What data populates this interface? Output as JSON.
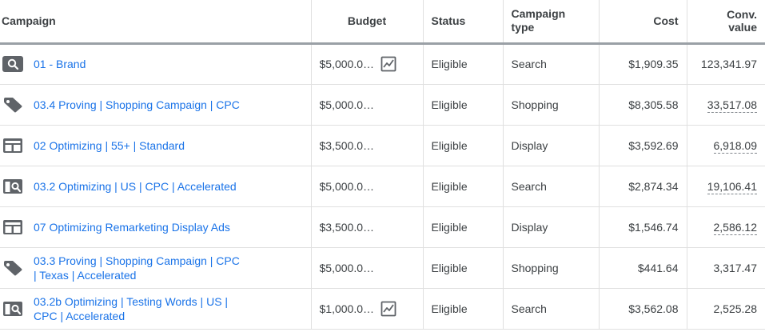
{
  "columns": {
    "campaign": "Campaign",
    "budget": "Budget",
    "status": "Status",
    "type_line1": "Campaign",
    "type_line2": "type",
    "cost": "Cost",
    "conv_value": "Conv. value"
  },
  "colors": {
    "link": "#1a73e8",
    "icon": "#5f6368",
    "text": "#3c4043"
  },
  "rows": [
    {
      "icon": "search-icon",
      "name": "01 - Brand",
      "budget": "$5,000.0…",
      "trend": true,
      "status": "Eligible",
      "type": "Search",
      "cost": "$1,909.35",
      "conv_value": "123,341.97",
      "conv_dashed": false
    },
    {
      "icon": "tag-icon",
      "name": "03.4 Proving | Shopping Campaign | CPC",
      "budget": "$5,000.0…",
      "trend": false,
      "status": "Eligible",
      "type": "Shopping",
      "cost": "$8,305.58",
      "conv_value": "33,517.08",
      "conv_dashed": true
    },
    {
      "icon": "display-icon",
      "name": "02 Optimizing | 55+ | Standard",
      "budget": "$3,500.0…",
      "trend": false,
      "status": "Eligible",
      "type": "Display",
      "cost": "$3,592.69",
      "conv_value": "6,918.09",
      "conv_dashed": true
    },
    {
      "icon": "search-network-icon",
      "name": "03.2 Optimizing | US | CPC | Accelerated",
      "budget": "$5,000.0…",
      "trend": false,
      "status": "Eligible",
      "type": "Search",
      "cost": "$2,874.34",
      "conv_value": "19,106.41",
      "conv_dashed": true
    },
    {
      "icon": "display-icon",
      "name": "07 Optimizing Remarketing Display Ads",
      "budget": "$3,500.0…",
      "trend": false,
      "status": "Eligible",
      "type": "Display",
      "cost": "$1,546.74",
      "conv_value": "2,586.12",
      "conv_dashed": true
    },
    {
      "icon": "tag-icon",
      "name": "03.3 Proving | Shopping Campaign | CPC | Texas | Accelerated",
      "budget": "$5,000.0…",
      "trend": false,
      "status": "Eligible",
      "type": "Shopping",
      "cost": "$441.64",
      "conv_value": "3,317.47",
      "conv_dashed": false
    },
    {
      "icon": "search-network-icon",
      "name": "03.2b Optimizing | Testing Words | US | CPC | Accelerated",
      "budget": "$1,000.0…",
      "trend": true,
      "status": "Eligible",
      "type": "Search",
      "cost": "$3,562.08",
      "conv_value": "2,525.28",
      "conv_dashed": false
    }
  ]
}
